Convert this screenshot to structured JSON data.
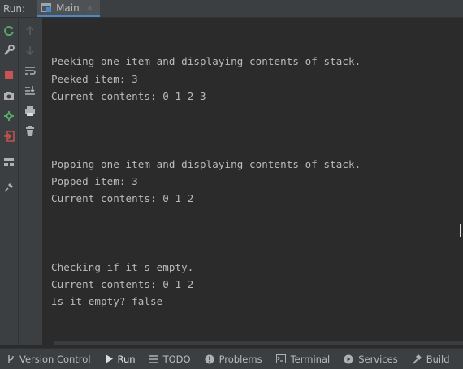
{
  "topbar": {
    "run_label": "Run:",
    "tab_label": "Main",
    "tab_close": "×"
  },
  "console": {
    "lines": [
      "Peeking one item and displaying contents of stack.",
      "Peeked item: 3",
      "Current contents: 0 1 2 3",
      "Popping one item and displaying contents of stack.",
      "Popped item: 3",
      "Current contents: 0 1 2",
      "Checking if it's empty.",
      "Current contents: 0 1 2",
      "Is it empty? false"
    ]
  },
  "bottombar": {
    "version_control": "Version Control",
    "run": "Run",
    "todo": "TODO",
    "problems": "Problems",
    "terminal": "Terminal",
    "services": "Services",
    "build": "Build"
  },
  "colors": {
    "background": "#2b2b2b",
    "panel": "#3c3f41",
    "accent": "#4a88c7",
    "rerun_green": "#59a869",
    "stop_red": "#c75450"
  },
  "icons": {
    "left_toolbar": [
      "rerun-icon",
      "wrench-icon",
      "stop-icon",
      "camera-icon",
      "settings-bug-icon",
      "exit-icon",
      "layout-icon",
      "pin-icon"
    ],
    "second_toolbar": [
      "up-arrow-icon",
      "down-arrow-icon",
      "soft-wrap-icon",
      "scroll-to-end-icon",
      "print-icon",
      "trash-icon"
    ]
  }
}
